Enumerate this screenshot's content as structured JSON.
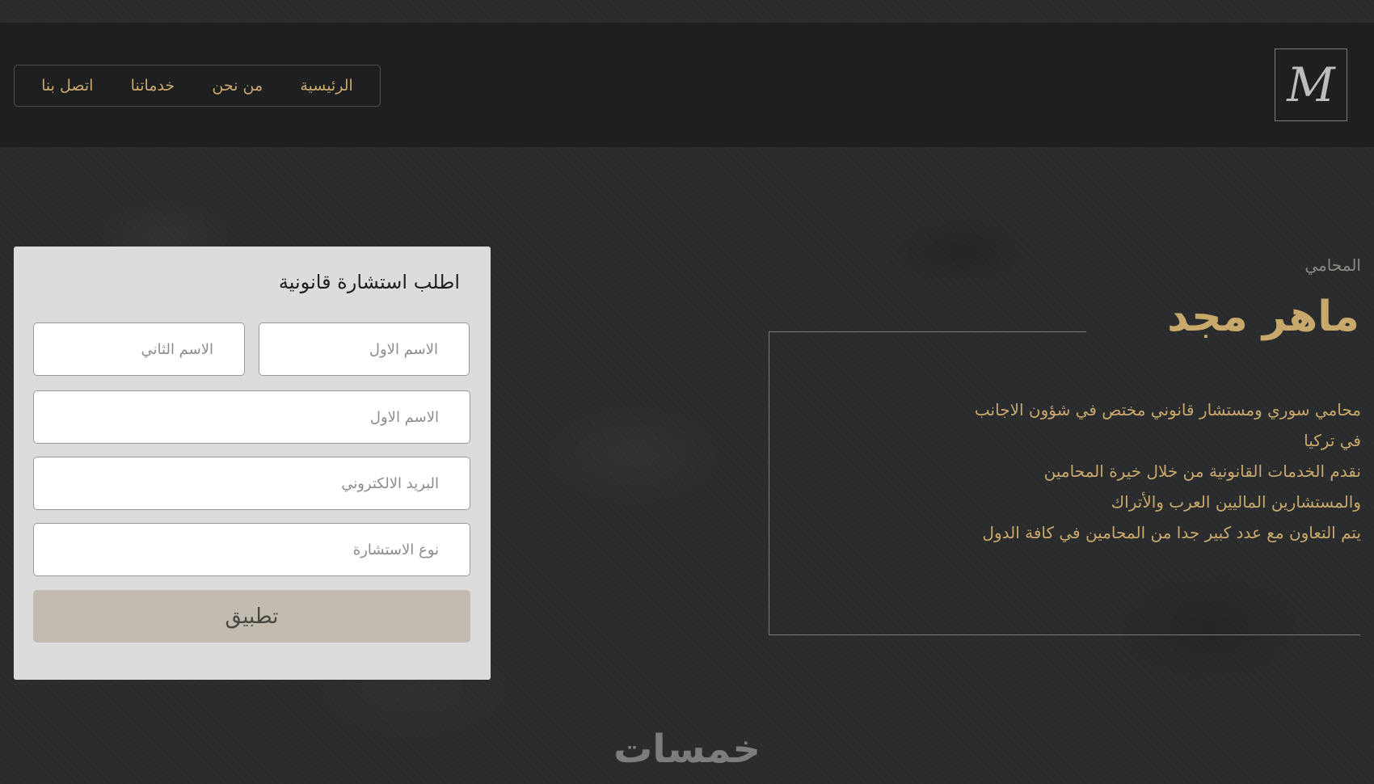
{
  "header": {
    "logo_letter": "M",
    "nav": [
      {
        "label": "الرئيسية"
      },
      {
        "label": "من نحن"
      },
      {
        "label": "خدماتنا"
      },
      {
        "label": "اتصل بنا"
      }
    ]
  },
  "hero": {
    "subtitle": "المحامي",
    "title": "ماهر مجد",
    "lines": [
      "محامي سوري ومستشار قانوني مختص في شؤون الاجانب",
      "في تركيا",
      "نقدم الخدمات القانونية من خلال خيرة المحامين",
      "والمستشارين الماليين العرب والأتراك",
      "يتم التعاون مع عدد كبير جدا من المحامين في كافة الدول"
    ]
  },
  "form": {
    "title": "اطلب استشارة قانونية",
    "first_name_placeholder": "الاسم الاول",
    "last_name_placeholder": "الاسم الثاني",
    "full_name_placeholder": "الاسم الاول",
    "email_placeholder": "البريد الالكتروني",
    "consultation_type_placeholder": "نوع الاستشارة",
    "submit_label": "تطبيق"
  },
  "watermark": "خمسات"
}
